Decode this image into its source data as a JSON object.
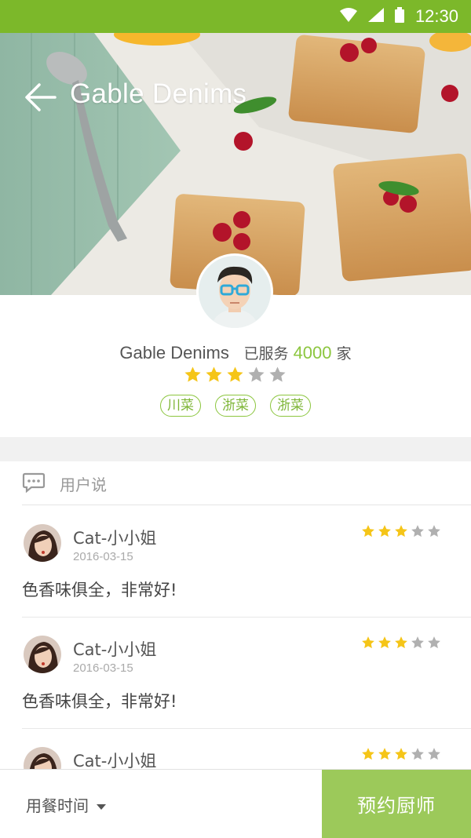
{
  "status_bar": {
    "time": "12:30"
  },
  "header": {
    "title": "Gable Denims"
  },
  "chef": {
    "name": "Gable Denims",
    "served_prefix": "已服务",
    "served_count": "4000",
    "served_suffix": "家",
    "rating": 3,
    "max_rating": 5,
    "tags": [
      "川菜",
      "浙菜",
      "浙菜"
    ]
  },
  "reviews": {
    "title": "用户说",
    "items": [
      {
        "user": "Cat-小小姐",
        "date": "2016-03-15",
        "rating": 3,
        "comment": "色香味俱全，非常好!"
      },
      {
        "user": "Cat-小小姐",
        "date": "2016-03-15",
        "rating": 3,
        "comment": "色香味俱全，非常好!"
      },
      {
        "user": "Cat-小小姐",
        "date": "",
        "rating": 3,
        "comment": ""
      }
    ]
  },
  "bottom_bar": {
    "time_label": "用餐时间",
    "book_label": "预约厨师"
  },
  "colors": {
    "accent": "#7cb82a",
    "star_on": "#f5c518",
    "star_off": "#b0b0b0",
    "button": "#9cc95a"
  },
  "icons": [
    "wifi-icon",
    "signal-icon",
    "battery-icon",
    "back-arrow-icon",
    "chat-bubble-icon",
    "star-icon",
    "caret-down-icon"
  ]
}
